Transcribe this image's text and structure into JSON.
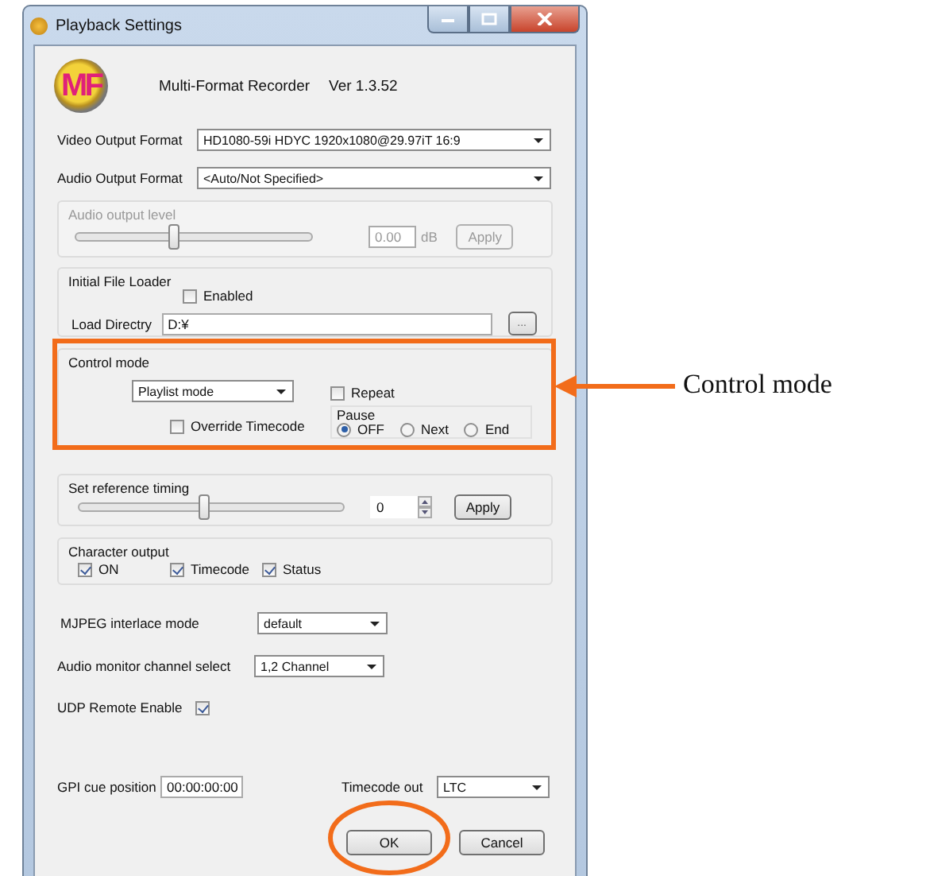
{
  "window": {
    "title": "Playback Settings"
  },
  "header": {
    "logo": "MF",
    "app_name": "Multi-Format Recorder",
    "version": "Ver 1.3.52"
  },
  "video_output_format": {
    "label": "Video Output Format",
    "value": "HD1080-59i HDYC 1920x1080@29.97iT 16:9"
  },
  "audio_output_format": {
    "label": "Audio Output Format",
    "value": "<Auto/Not Specified>"
  },
  "audio_output_level": {
    "title": "Audio output level",
    "disabled": true,
    "level": 0.41,
    "value": "0.00",
    "unit": "dB",
    "button": "Apply"
  },
  "initial_file_loader": {
    "title": "Initial File Loader",
    "enabled": {
      "label": "Enabled",
      "checked": false
    },
    "load_directory": {
      "label": "Load Directry",
      "value": "D:¥"
    },
    "browse_button": "..."
  },
  "control_mode": {
    "title": "Control mode",
    "mode": "Playlist mode",
    "repeat": {
      "label": "Repeat",
      "checked": false
    },
    "override_timecode": {
      "label": "Override Timecode",
      "checked": false
    },
    "pause": {
      "title": "Pause",
      "options": [
        {
          "label": "OFF",
          "selected": true
        },
        {
          "label": "Next",
          "selected": false
        },
        {
          "label": "End",
          "selected": false
        }
      ]
    }
  },
  "reference_timing": {
    "title": "Set reference timing",
    "level": 0.47,
    "value": "0",
    "button": "Apply"
  },
  "character_output": {
    "title": "Character output",
    "options": [
      {
        "label": "ON",
        "checked": true
      },
      {
        "label": "Timecode",
        "checked": true
      },
      {
        "label": "Status",
        "checked": true
      }
    ]
  },
  "mjpeg_interlace_mode": {
    "label": "MJPEG interlace mode",
    "value": "default"
  },
  "audio_monitor_channel": {
    "label": "Audio monitor channel select",
    "value": "1,2 Channel"
  },
  "udp_remote": {
    "label": "UDP Remote Enable",
    "checked": true
  },
  "gpi_cue_position": {
    "label": "GPI cue position",
    "value": "00:00:00:00"
  },
  "timecode_out": {
    "label": "Timecode out",
    "value": "LTC"
  },
  "buttons": [
    "OK",
    "Cancel"
  ],
  "annotation": {
    "label": "Control mode"
  }
}
